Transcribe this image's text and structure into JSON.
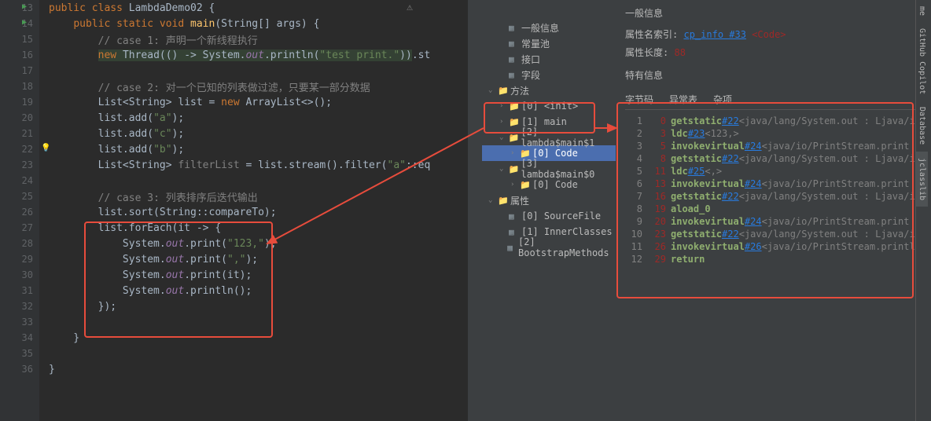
{
  "editor": {
    "lines": [
      {
        "n": 13,
        "gutter_icon": "▶",
        "tokens": [
          {
            "t": "public class ",
            "c": "kw"
          },
          {
            "t": "LambdaDemo02 ",
            "c": "cls"
          },
          {
            "t": "{",
            "c": "paren"
          }
        ]
      },
      {
        "n": 14,
        "gutter_icon": "▶",
        "tokens": [
          {
            "t": "    ",
            "c": ""
          },
          {
            "t": "public static void ",
            "c": "kw"
          },
          {
            "t": "main",
            "c": "method"
          },
          {
            "t": "(String[] args) {",
            "c": "cls"
          }
        ]
      },
      {
        "n": 15,
        "tokens": [
          {
            "t": "        ",
            "c": ""
          },
          {
            "t": "// case 1: 声明一个新线程执行",
            "c": "comment"
          }
        ]
      },
      {
        "n": 16,
        "tokens": [
          {
            "t": "        ",
            "c": ""
          },
          {
            "t": "new ",
            "c": "kw hl-new"
          },
          {
            "t": "Thread(() -> System.",
            "c": "cls hl-new"
          },
          {
            "t": "out",
            "c": "field hl-new"
          },
          {
            "t": ".println(",
            "c": "cls hl-new"
          },
          {
            "t": "\"test print.\"",
            "c": "str hl-new"
          },
          {
            "t": "))",
            "c": "cls hl-new"
          },
          {
            "t": ".st",
            "c": "cls"
          }
        ]
      },
      {
        "n": 17,
        "tokens": [
          {
            "t": "",
            "c": ""
          }
        ]
      },
      {
        "n": 18,
        "tokens": [
          {
            "t": "        ",
            "c": ""
          },
          {
            "t": "// case 2: 对一个已知的列表做过滤，只要某一部分数据",
            "c": "comment"
          }
        ]
      },
      {
        "n": 19,
        "tokens": [
          {
            "t": "        List<String> ",
            "c": "cls"
          },
          {
            "t": "list",
            "c": "cls"
          },
          {
            "t": " = ",
            "c": "cls"
          },
          {
            "t": "new ",
            "c": "kw"
          },
          {
            "t": "ArrayList<>();",
            "c": "cls"
          }
        ]
      },
      {
        "n": 20,
        "tokens": [
          {
            "t": "        list.add(",
            "c": "cls"
          },
          {
            "t": "\"a\"",
            "c": "str"
          },
          {
            "t": ");",
            "c": "cls"
          }
        ]
      },
      {
        "n": 21,
        "tokens": [
          {
            "t": "        list.add(",
            "c": "cls"
          },
          {
            "t": "\"c\"",
            "c": "str"
          },
          {
            "t": ");",
            "c": "cls"
          }
        ]
      },
      {
        "n": 22,
        "gutter_bulb": true,
        "tokens": [
          {
            "t": "        list.add(",
            "c": "cls"
          },
          {
            "t": "\"b\"",
            "c": "str"
          },
          {
            "t": ");",
            "c": "cls"
          }
        ]
      },
      {
        "n": 23,
        "tokens": [
          {
            "t": "        List<String> ",
            "c": "cls"
          },
          {
            "t": "filterList",
            "c": "comment"
          },
          {
            "t": " = list.stream().filter(",
            "c": "cls"
          },
          {
            "t": "\"a\"",
            "c": "str"
          },
          {
            "t": "::eq",
            "c": "cls"
          }
        ]
      },
      {
        "n": 24,
        "tokens": [
          {
            "t": "",
            "c": ""
          }
        ]
      },
      {
        "n": 25,
        "tokens": [
          {
            "t": "        ",
            "c": ""
          },
          {
            "t": "// case 3: 列表排序后迭代输出",
            "c": "comment"
          }
        ]
      },
      {
        "n": 26,
        "tokens": [
          {
            "t": "        list.sort(String::compareTo);",
            "c": "cls"
          }
        ]
      },
      {
        "n": 27,
        "tokens": [
          {
            "t": "        list.forEach(it -> {",
            "c": "cls"
          }
        ]
      },
      {
        "n": 28,
        "tokens": [
          {
            "t": "            System.",
            "c": "cls"
          },
          {
            "t": "out",
            "c": "field"
          },
          {
            "t": ".print(",
            "c": "cls"
          },
          {
            "t": "\"123,\"",
            "c": "str"
          },
          {
            "t": ");",
            "c": "cls"
          }
        ]
      },
      {
        "n": 29,
        "tokens": [
          {
            "t": "            System.",
            "c": "cls"
          },
          {
            "t": "out",
            "c": "field"
          },
          {
            "t": ".print(",
            "c": "cls"
          },
          {
            "t": "\",\"",
            "c": "str"
          },
          {
            "t": ");",
            "c": "cls"
          }
        ]
      },
      {
        "n": 30,
        "tokens": [
          {
            "t": "            System.",
            "c": "cls"
          },
          {
            "t": "out",
            "c": "field"
          },
          {
            "t": ".print(it);",
            "c": "cls"
          }
        ]
      },
      {
        "n": 31,
        "tokens": [
          {
            "t": "            System.",
            "c": "cls"
          },
          {
            "t": "out",
            "c": "field"
          },
          {
            "t": ".println();",
            "c": "cls"
          }
        ]
      },
      {
        "n": 32,
        "tokens": [
          {
            "t": "        });",
            "c": "cls"
          }
        ]
      },
      {
        "n": 33,
        "tokens": [
          {
            "t": "",
            "c": ""
          }
        ]
      },
      {
        "n": 34,
        "tokens": [
          {
            "t": "    }",
            "c": "cls"
          }
        ]
      },
      {
        "n": 35,
        "tokens": [
          {
            "t": "",
            "c": ""
          }
        ]
      },
      {
        "n": 36,
        "tokens": [
          {
            "t": "}",
            "c": "cls"
          }
        ]
      }
    ]
  },
  "tree": {
    "items": [
      {
        "indent": 1,
        "arrow": "",
        "icon": "▦",
        "label": "一般信息"
      },
      {
        "indent": 1,
        "arrow": "",
        "icon": "▦",
        "label": "常量池"
      },
      {
        "indent": 1,
        "arrow": "",
        "icon": "▦",
        "label": "接口"
      },
      {
        "indent": 1,
        "arrow": "",
        "icon": "▦",
        "label": "字段"
      },
      {
        "indent": 0,
        "arrow": "⌄",
        "icon": "📁",
        "label": "方法"
      },
      {
        "indent": 1,
        "arrow": "›",
        "icon": "📁",
        "label": "[0] <init>"
      },
      {
        "indent": 1,
        "arrow": "›",
        "icon": "📁",
        "label": "[1] main"
      },
      {
        "indent": 1,
        "arrow": "⌄",
        "icon": "📁",
        "label": "[2] lambda$main$1"
      },
      {
        "indent": 2,
        "arrow": "›",
        "icon": "📁",
        "label": "[0] Code",
        "selected": true
      },
      {
        "indent": 1,
        "arrow": "⌄",
        "icon": "📁",
        "label": "[3] lambda$main$0"
      },
      {
        "indent": 2,
        "arrow": "›",
        "icon": "📁",
        "label": "[0] Code"
      },
      {
        "indent": 0,
        "arrow": "⌄",
        "icon": "📁",
        "label": "属性"
      },
      {
        "indent": 1,
        "arrow": "",
        "icon": "▦",
        "label": "[0] SourceFile"
      },
      {
        "indent": 1,
        "arrow": "",
        "icon": "▦",
        "label": "[1] InnerClasses"
      },
      {
        "indent": 1,
        "arrow": "",
        "icon": "▦",
        "label": "[2] BootstrapMethods"
      }
    ]
  },
  "detail": {
    "title": "一般信息",
    "attr_name_label": "属性名索引:",
    "attr_name_link": "cp_info #33",
    "attr_name_code": "<Code>",
    "attr_len_label": "属性长度:",
    "attr_len_value": "88",
    "spec_label": "特有信息",
    "tabs": [
      "字节码",
      "异常表",
      "杂项"
    ]
  },
  "bytecode": [
    {
      "ln": 1,
      "off": "0",
      "op": "getstatic",
      "ref": "#22",
      "cmt": "<java/lang/System.out : Ljava/io"
    },
    {
      "ln": 2,
      "off": "3",
      "op": "ldc",
      "ref": "#23",
      "cmt": "<123,>"
    },
    {
      "ln": 3,
      "off": "5",
      "op": "invokevirtual",
      "ref": "#24",
      "cmt": "<java/io/PrintStream.print :"
    },
    {
      "ln": 4,
      "off": "8",
      "op": "getstatic",
      "ref": "#22",
      "cmt": "<java/lang/System.out : Ljava/io"
    },
    {
      "ln": 5,
      "off": "11",
      "op": "ldc",
      "ref": "#25",
      "cmt": "<,>"
    },
    {
      "ln": 6,
      "off": "13",
      "op": "invokevirtual",
      "ref": "#24",
      "cmt": "<java/io/PrintStream.print :"
    },
    {
      "ln": 7,
      "off": "16",
      "op": "getstatic",
      "ref": "#22",
      "cmt": "<java/lang/System.out : Ljava/io"
    },
    {
      "ln": 8,
      "off": "19",
      "op": "aload_0",
      "ref": "",
      "cmt": ""
    },
    {
      "ln": 9,
      "off": "20",
      "op": "invokevirtual",
      "ref": "#24",
      "cmt": "<java/io/PrintStream.print :"
    },
    {
      "ln": 10,
      "off": "23",
      "op": "getstatic",
      "ref": "#22",
      "cmt": "<java/lang/System.out : Ljava/io"
    },
    {
      "ln": 11,
      "off": "26",
      "op": "invokevirtual",
      "ref": "#26",
      "cmt": "<java/io/PrintStream.println"
    },
    {
      "ln": 12,
      "off": "29",
      "op": "return",
      "ref": "",
      "cmt": ""
    }
  ],
  "side_tabs": [
    "me",
    "GitHub Copilot",
    "Database",
    "jclasslib"
  ]
}
